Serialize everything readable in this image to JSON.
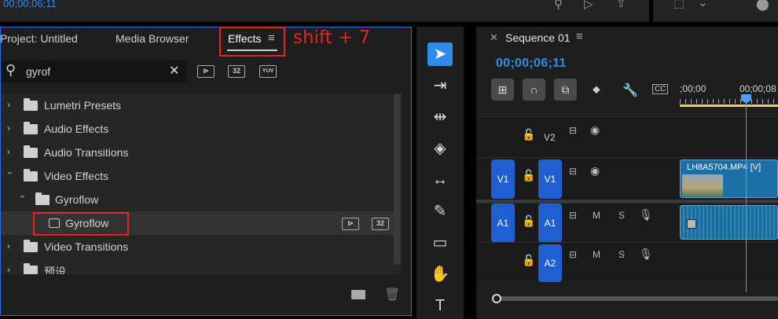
{
  "topbar": {
    "timecode": "00;00;06;11"
  },
  "panel": {
    "tabs": [
      {
        "label": "Project: Untitled"
      },
      {
        "label": "Media Browser"
      },
      {
        "label": "Effects"
      }
    ],
    "annotation": "shift + 7",
    "search": {
      "value": "gyrof"
    },
    "filter_buttons": [
      "accelerated-effects",
      "32",
      "YUV"
    ],
    "tree": [
      {
        "label": "Lumetri Presets"
      },
      {
        "label": "Audio Effects"
      },
      {
        "label": "Audio Transitions"
      },
      {
        "label": "Video Effects"
      },
      {
        "label": "Gyroflow"
      },
      {
        "label": "Gyroflow",
        "badge": "32"
      },
      {
        "label": "Video Transitions"
      },
      {
        "label": "预设"
      }
    ]
  },
  "sequence": {
    "title": "Sequence 01",
    "timecode": "00;00;06;11",
    "ruler": {
      "t0": ";00;00",
      "t1": "00;00;08"
    },
    "tracks": {
      "v2": "V2",
      "v1_src": "V1",
      "v1": "V1",
      "a1_src": "A1",
      "a1": "A1",
      "a2": "A2",
      "m": "M",
      "s": "S"
    },
    "clip_name": "LH8A5704.MP4 [V]"
  },
  "colors": {
    "accent": "#2d8ceb",
    "annotation": "#e0261e",
    "clip": "#1d6fa8"
  }
}
